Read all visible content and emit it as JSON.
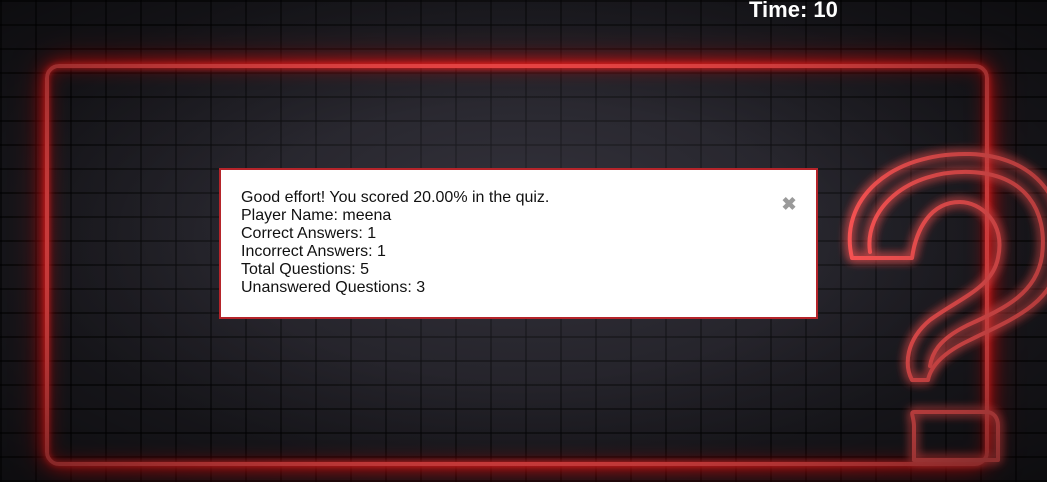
{
  "timer": {
    "label": "Time: 10"
  },
  "result_modal": {
    "score_message": "Good effort! You scored 20.00% in the quiz.",
    "player_name": "Player Name: meena",
    "correct_answers": "Correct Answers: 1",
    "incorrect_answers": "Incorrect Answers: 1",
    "total_questions": "Total Questions: 5",
    "unanswered_questions": "Unanswered Questions: 3",
    "close_icon": "close-icon",
    "close_glyph": "✖"
  },
  "colors": {
    "neon_red": "#ff4a4a",
    "modal_border": "#b5242a",
    "brick_wall": "#1d1c22"
  }
}
